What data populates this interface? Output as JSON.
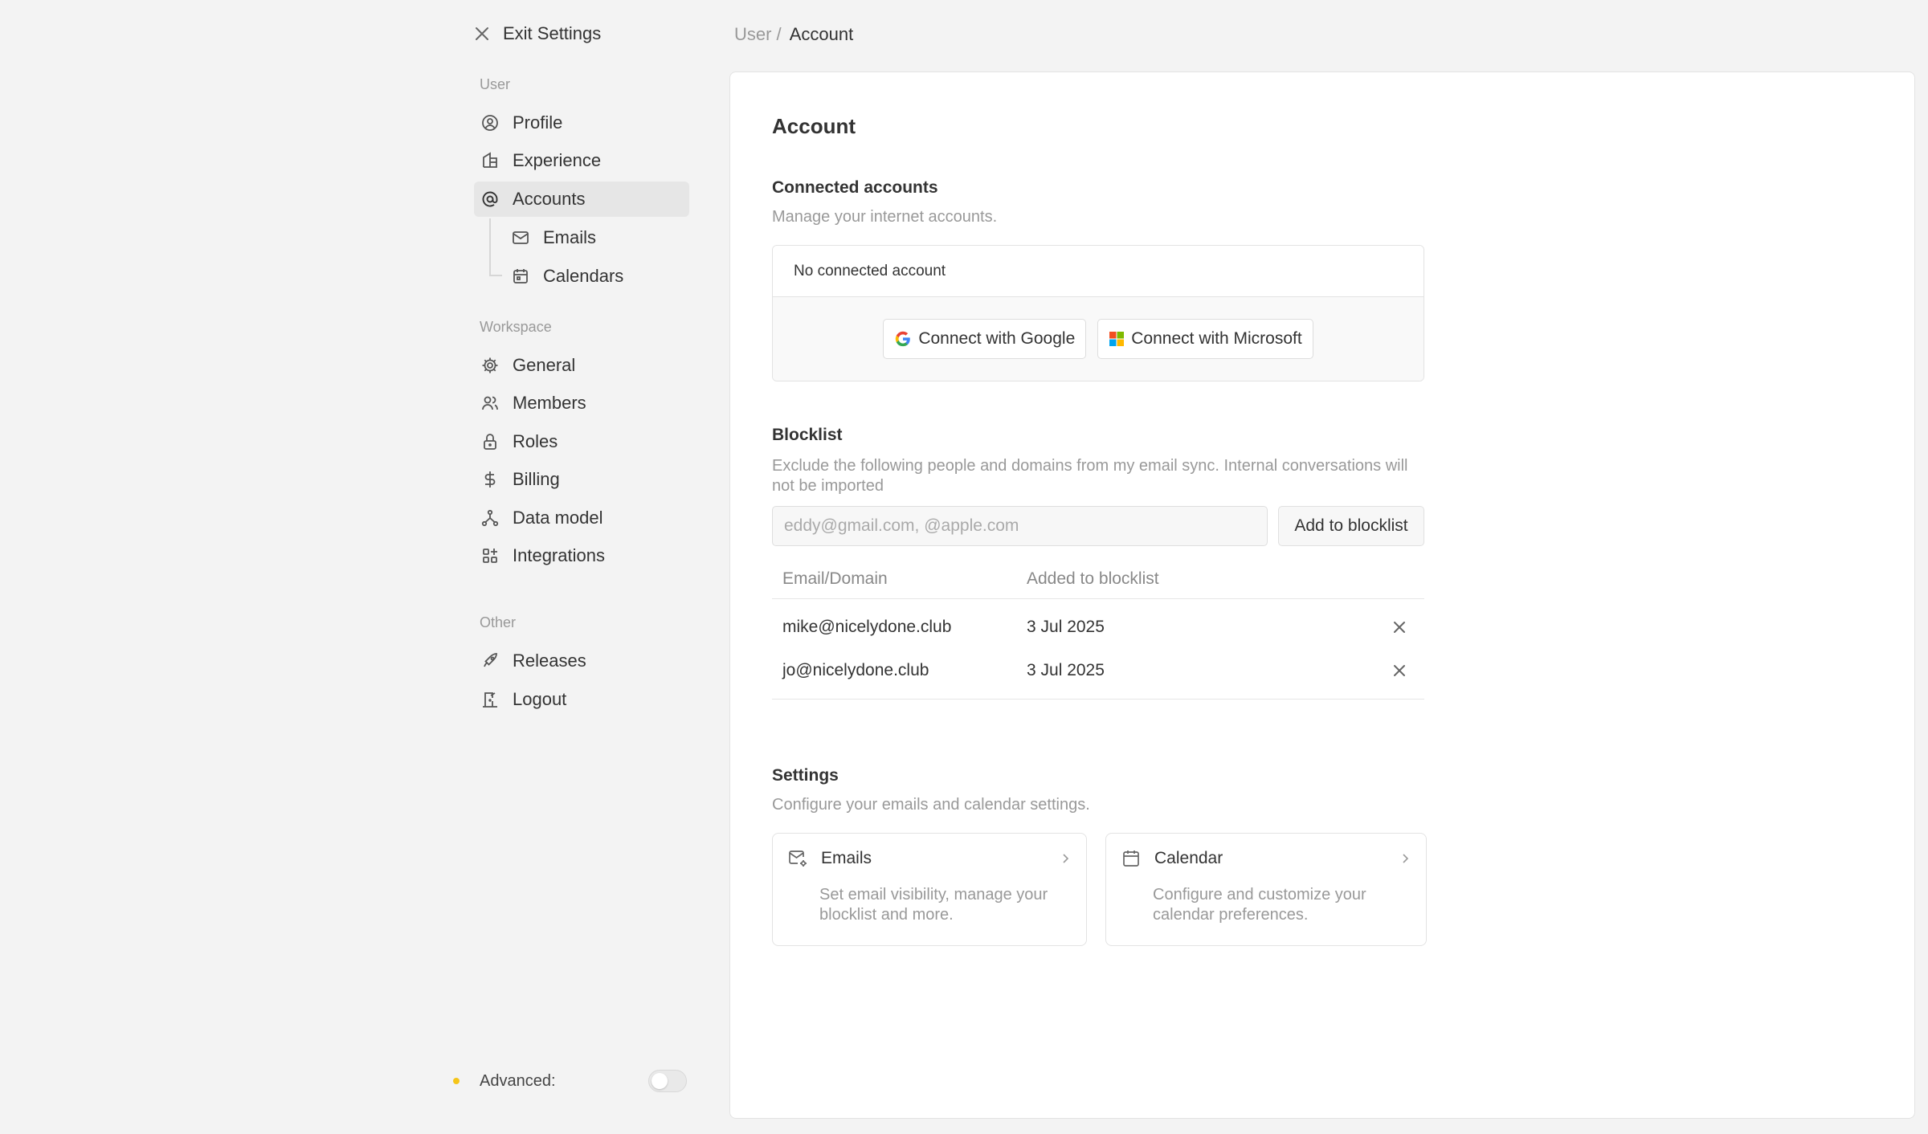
{
  "sidebar": {
    "exit_label": "Exit Settings",
    "user_label": "User",
    "workspace_label": "Workspace",
    "other_label": "Other",
    "items": {
      "profile": "Profile",
      "experience": "Experience",
      "accounts": "Accounts",
      "emails": "Emails",
      "calendars": "Calendars",
      "general": "General",
      "members": "Members",
      "roles": "Roles",
      "billing": "Billing",
      "data_model": "Data model",
      "integrations": "Integrations",
      "releases": "Releases",
      "logout": "Logout"
    },
    "advanced_label": "Advanced:",
    "advanced_enabled": false,
    "advanced_dot_color": "#f5c518"
  },
  "breadcrumb": {
    "parent": "User /",
    "current": "Account"
  },
  "page": {
    "title": "Account",
    "connected": {
      "title": "Connected accounts",
      "description": "Manage your internet accounts.",
      "empty_label": "No connected account",
      "google_button": "Connect with Google",
      "microsoft_button": "Connect with Microsoft"
    },
    "blocklist": {
      "title": "Blocklist",
      "description": "Exclude the following people and domains from my email sync. Internal conversations will not be imported",
      "input_placeholder": "eddy@gmail.com, @apple.com",
      "add_button": "Add to blocklist",
      "columns": [
        "Email/Domain",
        "Added to blocklist"
      ],
      "rows": [
        {
          "email": "mike@nicelydone.club",
          "added": "3 Jul 2025"
        },
        {
          "email": "jo@nicelydone.club",
          "added": "3 Jul 2025"
        }
      ]
    },
    "settings": {
      "title": "Settings",
      "description": "Configure your emails and calendar settings.",
      "cards": [
        {
          "title": "Emails",
          "description": "Set email visibility, manage your blocklist and more."
        },
        {
          "title": "Calendar",
          "description": "Configure and customize your calendar preferences."
        }
      ]
    }
  }
}
